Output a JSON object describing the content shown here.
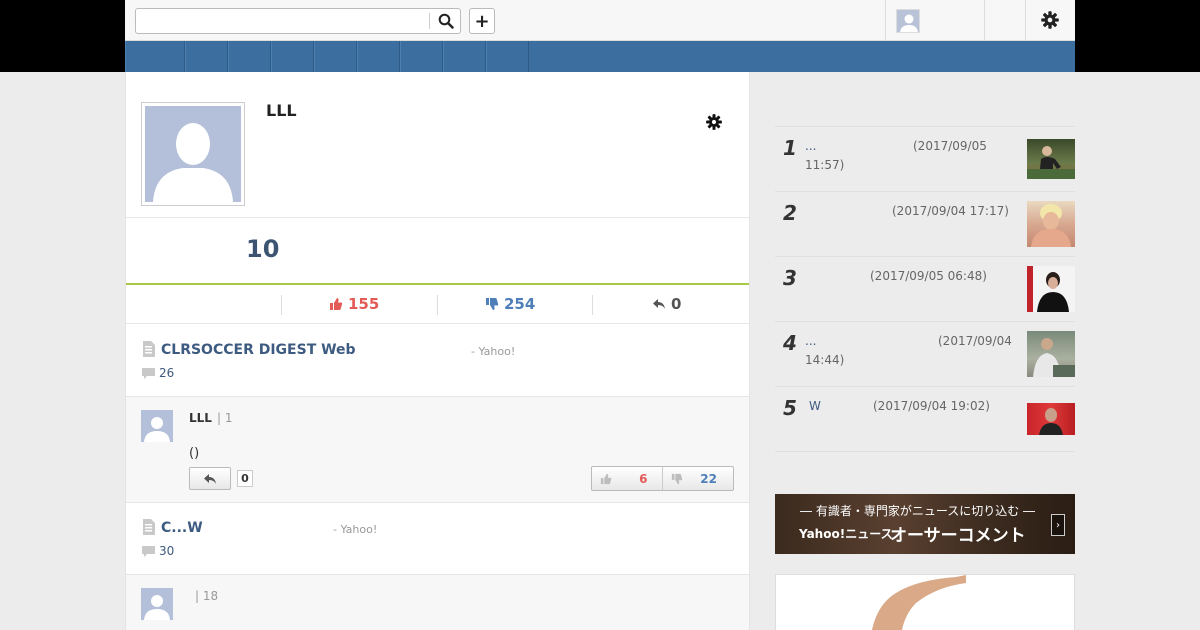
{
  "search": {
    "placeholder": ""
  },
  "header": {
    "plus_label": "+"
  },
  "nav": {
    "tabs": [
      "",
      "",
      "",
      "",
      "",
      "",
      "",
      "",
      ""
    ]
  },
  "profile": {
    "name": "LLL",
    "count": "10"
  },
  "stats": {
    "likes": "155",
    "dislikes": "254",
    "replies": "0"
  },
  "articles": [
    {
      "title": "CLRSOCCER DIGEST Web",
      "source": "- Yahoo!",
      "comment_count": "26"
    },
    {
      "title": "C...W",
      "source": "- Yahoo!",
      "comment_count": "30"
    }
  ],
  "comments": [
    {
      "user": "LLL",
      "number": "| 1",
      "text": "()",
      "reply_count": "0",
      "up_votes": "6",
      "down_votes": "22"
    },
    {
      "user": "",
      "number": "| 18"
    }
  ],
  "ranking": [
    {
      "rank": "1",
      "title": "...",
      "date": "(2017/09/05",
      "date2": "11:57)"
    },
    {
      "rank": "2",
      "title": "",
      "date": "(2017/09/04 17:17)"
    },
    {
      "rank": "3",
      "title": "",
      "date": "(2017/09/05 06:48)"
    },
    {
      "rank": "4",
      "title": "...",
      "date": "(2017/09/04",
      "date2": "14:44)"
    },
    {
      "rank": "5",
      "title": "W",
      "date": "(2017/09/04 19:02)"
    }
  ],
  "banner": {
    "line1": "― 有識者・専門家がニュースに切り込む ―",
    "brand": "Yahoo!ニュース",
    "title": "オーサーコメント"
  },
  "colors": {
    "nav": "#3c6e9f",
    "accent_green": "#a8c94a",
    "like": "#e35b57",
    "dislike": "#4f7fb8",
    "link": "#3d5a80"
  },
  "icons": [
    "search-icon",
    "plus-icon",
    "gear-icon",
    "thumbs-up-icon",
    "thumbs-down-icon",
    "reply-icon",
    "document-icon",
    "speech-bubble-icon",
    "chevron-right-icon"
  ]
}
